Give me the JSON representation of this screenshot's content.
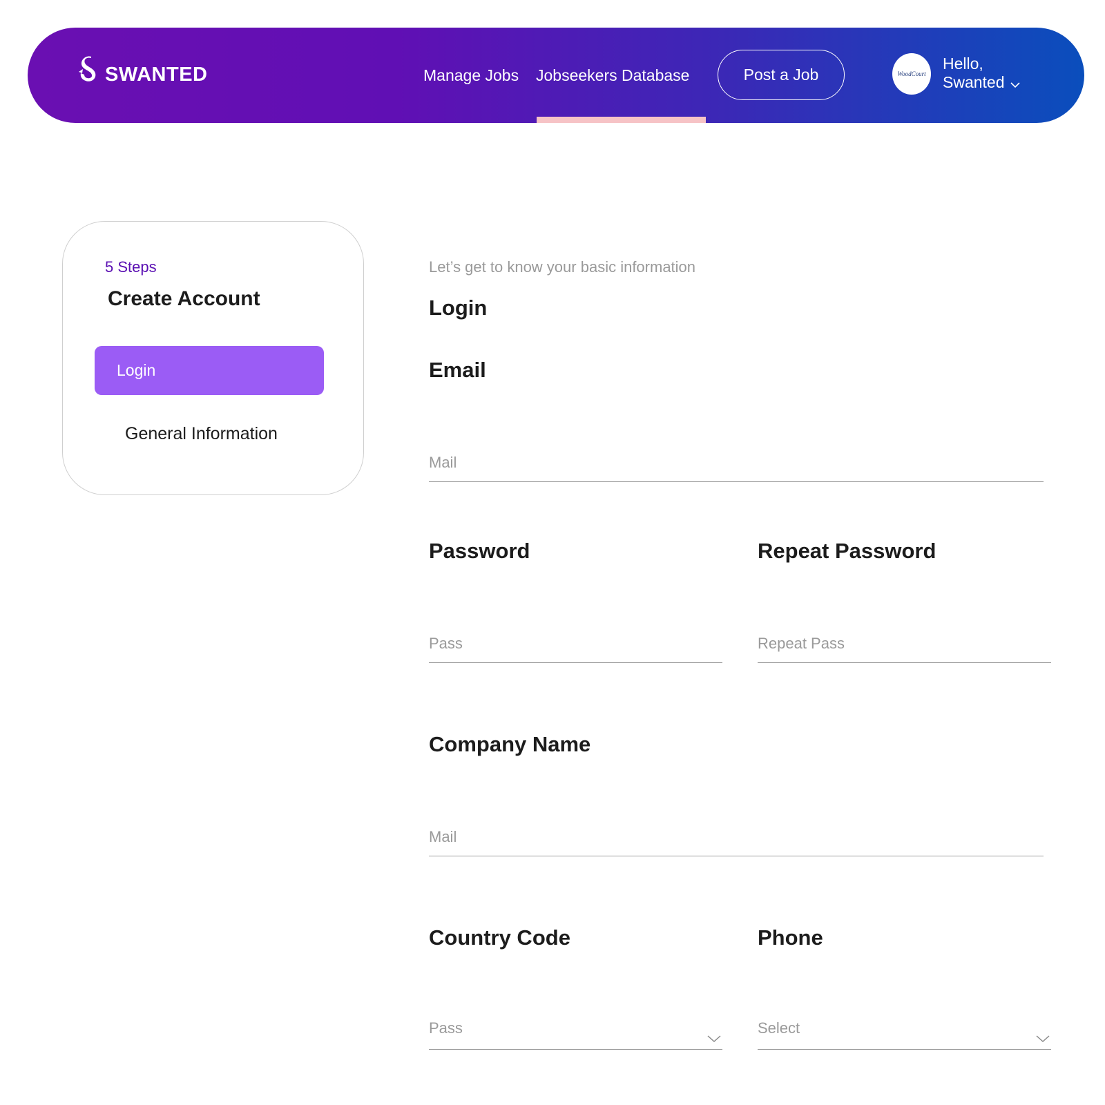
{
  "header": {
    "brand": "SWANTED",
    "nav": {
      "manage_jobs": "Manage Jobs",
      "jobseekers_database": "Jobseekers Database"
    },
    "post_job_label": "Post a Job",
    "avatar_text": "WoodCourt",
    "user_greeting": "Hello,",
    "user_name": "Swanted",
    "active_tab_color": "#f6c3c6"
  },
  "steps": {
    "count_label": "5 Steps",
    "title": "Create Account",
    "items": [
      {
        "label": "Login",
        "active": true
      },
      {
        "label": "General Information",
        "active": false
      }
    ],
    "active_color": "#9b5cf5"
  },
  "form": {
    "intro": "Let’s get to know your basic information",
    "heading": "Login",
    "email": {
      "label": "Email",
      "placeholder": "Mail"
    },
    "password": {
      "label": "Password",
      "placeholder": "Pass"
    },
    "repeat_password": {
      "label": "Repeat Password",
      "placeholder": "Repeat Pass"
    },
    "company_name": {
      "label": "Company Name",
      "placeholder": "Mail"
    },
    "country_code": {
      "label": "Country Code",
      "placeholder": "Pass"
    },
    "phone": {
      "label": "Phone",
      "placeholder": "Select"
    }
  },
  "icons": {
    "logo": "swan-logo-icon",
    "chevron": "chevron-down-icon"
  },
  "colors": {
    "header_start": "#6a0fb2",
    "header_end": "#0a4ebc",
    "steps_accent": "#5a0fb2"
  }
}
